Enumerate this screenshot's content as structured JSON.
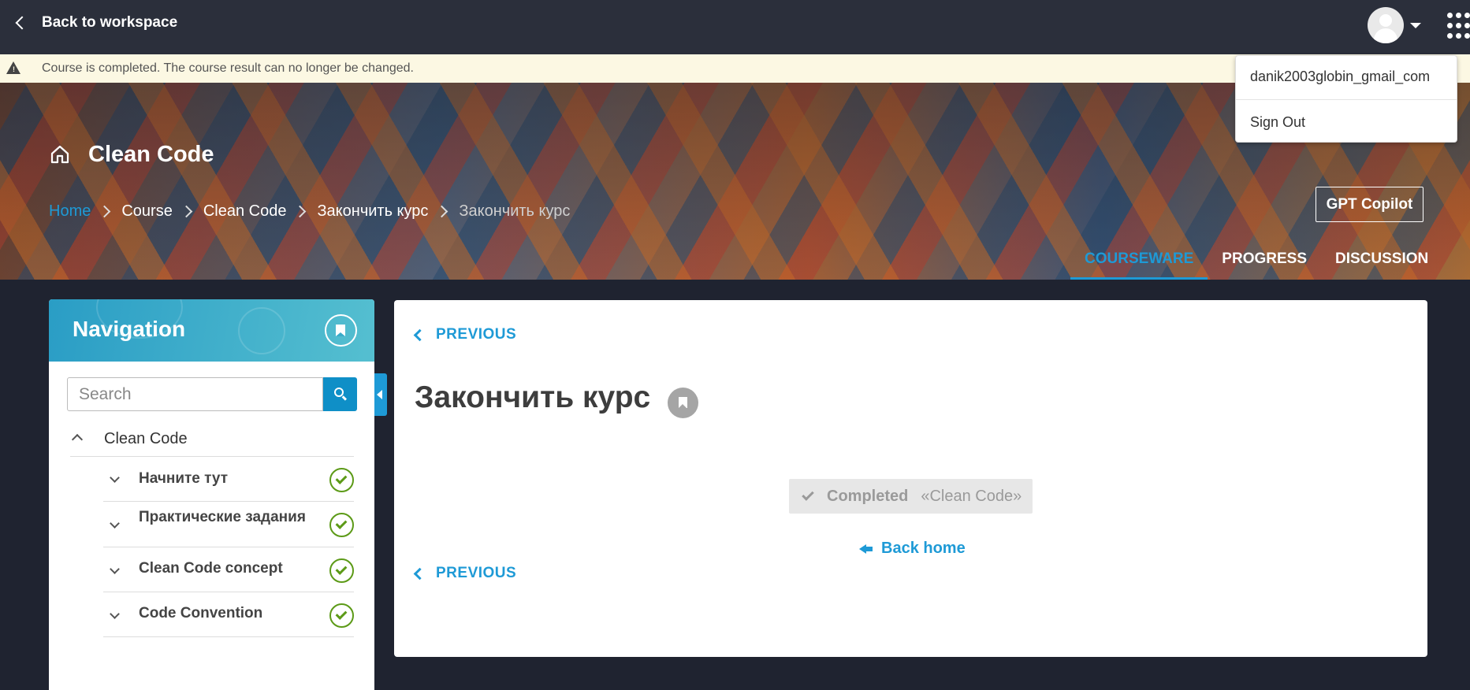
{
  "topbar": {
    "back_label": "Back to workspace"
  },
  "alert": {
    "text": "Course is completed. The course result can no longer be changed."
  },
  "user_menu": {
    "username": "danik2003globin_gmail_com",
    "sign_out": "Sign Out"
  },
  "hero": {
    "course_title": "Clean Code",
    "breadcrumbs": [
      "Home",
      "Course",
      "Clean Code",
      "Закончить курс",
      "Закончить курс"
    ],
    "gpt_button": "GPT Copilot",
    "tabs": [
      "COURSEWARE",
      "PROGRESS",
      "DISCUSSION"
    ],
    "active_tab": "COURSEWARE"
  },
  "sidebar": {
    "title": "Navigation",
    "search_placeholder": "Search",
    "root": "Clean Code",
    "items": [
      {
        "label": "Начните тут",
        "completed": true
      },
      {
        "label": "Практические задания",
        "completed": true
      },
      {
        "label": "Clean Code concept",
        "completed": true
      },
      {
        "label": "Code Convention",
        "completed": true
      }
    ]
  },
  "content": {
    "previous_top": "PREVIOUS",
    "unit_title": "Закончить курс",
    "completed_label": "Completed",
    "completed_course": "«Clean Code»",
    "back_home": "Back home",
    "previous_bottom": "PREVIOUS"
  },
  "colors": {
    "accent": "#1e9ad6",
    "topbar": "#2b2f3b",
    "alert_bg": "#fcf8e3",
    "success": "#5c9a17"
  },
  "icons": [
    "chevron-left-icon",
    "avatar-icon",
    "caret-down-icon",
    "apps-grid-icon",
    "warning-icon",
    "home-icon",
    "bookmark-icon",
    "search-icon",
    "check-circle-icon",
    "arrow-left-icon"
  ]
}
